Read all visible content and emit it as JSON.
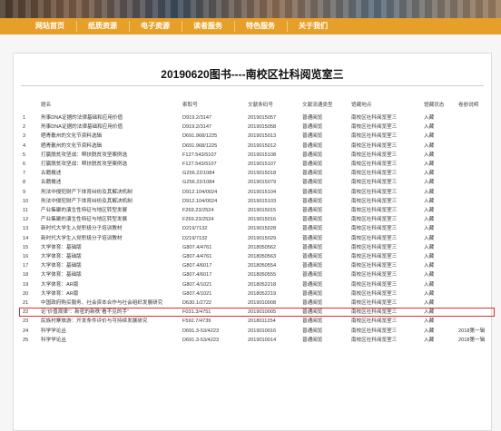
{
  "nav": {
    "items": [
      "网站首页",
      "纸质资源",
      "电子资源",
      "读者服务",
      "特色服务",
      "关于我们"
    ]
  },
  "page_title": "20190620图书----南校区社科阅览室三",
  "table": {
    "headers": [
      "",
      "题名",
      "索取号",
      "文献条码号",
      "文献流通类型",
      "馆藏地点",
      "馆藏状态",
      "卷册说明"
    ],
    "rows": [
      [
        "1",
        "刑事DNA证据的法律基础和应用价值",
        "D919.2/3147",
        "2019015057",
        "普通阅览",
        "南校区社科阅览室三",
        "入藏",
        ""
      ],
      [
        "2",
        "刑事DNA证据的法律基础和应用价值",
        "D919.2/3147",
        "2019015058",
        "普通阅览",
        "南校区社科阅览室三",
        "入藏",
        ""
      ],
      [
        "3",
        "晒青散州的文化节资料选辑",
        "D691.968/1225",
        "2019015013",
        "普通阅览",
        "南校区社科阅览室三",
        "入藏",
        ""
      ],
      [
        "4",
        "晒青散州的文化节资料选辑",
        "D691.968/1225",
        "2019015012",
        "普通阅览",
        "南校区社科阅览室三",
        "入藏",
        ""
      ],
      [
        "5",
        "打赢脱贫攻坚战：帮扶脱贫攻坚案例选",
        "F127.543/5107",
        "2019015108",
        "普通阅览",
        "南校区社科阅览室三",
        "入藏",
        ""
      ],
      [
        "6",
        "打赢脱贫攻坚战：帮扶脱贫攻坚案例选",
        "F127.543/5107",
        "2019015107",
        "普通阅览",
        "南校区社科阅览室三",
        "入藏",
        ""
      ],
      [
        "7",
        "古籍概述",
        "G256.22/1084",
        "2019015018",
        "普通阅览",
        "南校区社科阅览室三",
        "入藏",
        ""
      ],
      [
        "8",
        "古籍概述",
        "G256.22/1084",
        "2019015079",
        "普通阅览",
        "南校区社科阅览室三",
        "入藏",
        ""
      ],
      [
        "9",
        "刑法中侵犯财产下体育纠纷及其解决机制",
        "D912.104/0024",
        "2019015104",
        "普通阅览",
        "南校区社科阅览室三",
        "入藏",
        ""
      ],
      [
        "10",
        "刑法中侵犯财产下体育纠纷及其解决机制",
        "D912.104/0024",
        "2019015103",
        "普通阅览",
        "南校区社科阅览室三",
        "入藏",
        ""
      ],
      [
        "11",
        "产业集聚的演生性特征与地区转型发展",
        "F269.23/2524",
        "2019015015",
        "普通阅览",
        "南校区社科阅览室三",
        "入藏",
        ""
      ],
      [
        "12",
        "产业集聚的演生性特征与地区转型发展",
        "F269.23/2524",
        "2019015016",
        "普通阅览",
        "南校区社科阅览室三",
        "入藏",
        ""
      ],
      [
        "13",
        "新时代大学生入党积极分子培训教材",
        "D219/7132",
        "2019015028",
        "普通阅览",
        "南校区社科阅览室三",
        "入藏",
        ""
      ],
      [
        "14",
        "新时代大学生入党积极分子培训教材",
        "D219/7132",
        "2019015029",
        "普通阅览",
        "南校区社科阅览室三",
        "入藏",
        ""
      ],
      [
        "15",
        "大学体育：基础版",
        "G807.4/4761",
        "2018050562",
        "普通阅览",
        "南校区社科阅览室三",
        "入藏",
        ""
      ],
      [
        "16",
        "大学体育：基础版",
        "G807.4/4761",
        "2018050563",
        "普通阅览",
        "南校区社科阅览室三",
        "入藏",
        ""
      ],
      [
        "17",
        "大学体育：基础版",
        "G807.4/6017",
        "2018050554",
        "普通阅览",
        "南校区社科阅览室三",
        "入藏",
        ""
      ],
      [
        "18",
        "大学体育：基础版",
        "G807.4/6017",
        "2018050555",
        "普通阅览",
        "南校区社科阅览室三",
        "入藏",
        ""
      ],
      [
        "19",
        "大学体育：AR版",
        "G807.4/1021",
        "2018052218",
        "普通阅览",
        "南校区社科阅览室三",
        "入藏",
        ""
      ],
      [
        "20",
        "大学体育：AR版",
        "G807.4/1021",
        "2018052219",
        "普通阅览",
        "南校区社科阅览室三",
        "入藏",
        ""
      ],
      [
        "21",
        "中国政府购买服务、社会资本合作与社会组织发展研究",
        "D630.1/2722",
        "2019010008",
        "普通阅览",
        "南校区社科阅览室三",
        "入藏",
        ""
      ],
      [
        "22",
        "论“价值观律”：新密的新秩“看不见的手”",
        "F031.3/4751",
        "2019010005",
        "普通阅览",
        "南校区社科阅览室三",
        "入藏",
        ""
      ],
      [
        "23",
        "民族村寨旅游：开发条件评价与可持续发展研究",
        "F592.7/4739",
        "2018011254",
        "普通阅览",
        "南校区社科阅览室三",
        "入藏",
        ""
      ],
      [
        "24",
        "科学学论丛",
        "D691.3-53/4223",
        "2019010016",
        "普通阅览",
        "南校区社科阅览室三",
        "入藏",
        "2018第一辑"
      ],
      [
        "25",
        "科学学论丛",
        "D691.3-53/4223",
        "2019010014",
        "普通阅览",
        "南校区社科阅览室三",
        "入藏",
        "2018第一辑"
      ]
    ],
    "highlighted_row_index": 21
  },
  "colors": {
    "nav_bg": "#e6a02a",
    "highlight_border": "#e03030"
  }
}
